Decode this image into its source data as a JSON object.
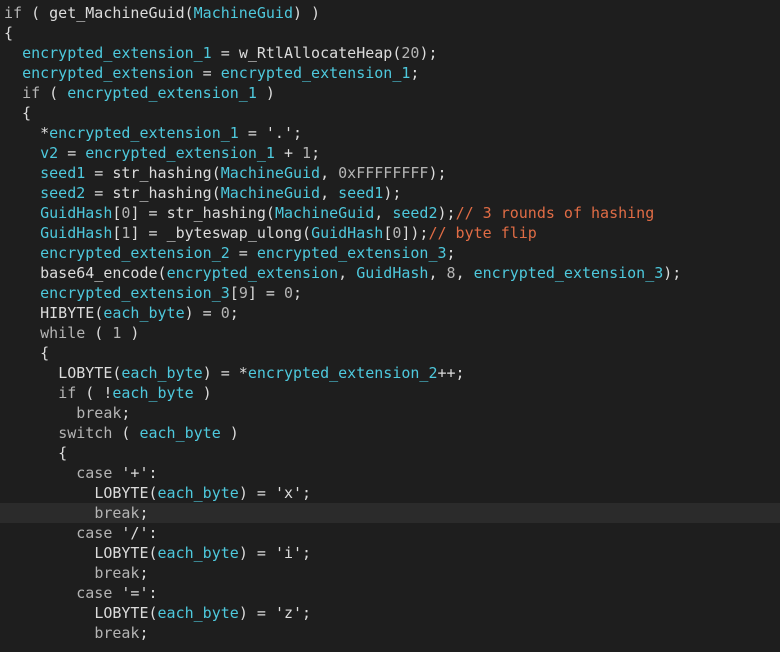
{
  "editor": {
    "current_line_index": 25,
    "colors": {
      "background": "#1e1e1e",
      "current_line": "#2b2b2b",
      "plain": "#dcdcdc",
      "keyword": "#b4b4b4",
      "variable": "#4ec9dd",
      "comment": "#e06c45",
      "number": "#b5b5b5"
    },
    "lines": [
      [
        [
          "k",
          "if"
        ],
        [
          "p",
          " ( "
        ],
        [
          "f",
          "get_MachineGuid"
        ],
        [
          "p",
          "("
        ],
        [
          "v",
          "MachineGuid"
        ],
        [
          "p",
          ") )"
        ]
      ],
      [
        [
          "p",
          "{"
        ]
      ],
      [
        [
          "p",
          "  "
        ],
        [
          "v",
          "encrypted_extension_1"
        ],
        [
          "p",
          " = "
        ],
        [
          "f",
          "w_RtlAllocateHeap"
        ],
        [
          "p",
          "("
        ],
        [
          "n",
          "20"
        ],
        [
          "p",
          ");"
        ]
      ],
      [
        [
          "p",
          "  "
        ],
        [
          "v",
          "encrypted_extension"
        ],
        [
          "p",
          " = "
        ],
        [
          "v",
          "encrypted_extension_1"
        ],
        [
          "p",
          ";"
        ]
      ],
      [
        [
          "p",
          "  "
        ],
        [
          "k",
          "if"
        ],
        [
          "p",
          " ( "
        ],
        [
          "v",
          "encrypted_extension_1"
        ],
        [
          "p",
          " )"
        ]
      ],
      [
        [
          "p",
          "  {"
        ]
      ],
      [
        [
          "p",
          "    *"
        ],
        [
          "v",
          "encrypted_extension_1"
        ],
        [
          "p",
          " = "
        ],
        [
          "s",
          "'.'"
        ],
        [
          "p",
          ";"
        ]
      ],
      [
        [
          "p",
          "    "
        ],
        [
          "v",
          "v2"
        ],
        [
          "p",
          " = "
        ],
        [
          "v",
          "encrypted_extension_1"
        ],
        [
          "p",
          " + "
        ],
        [
          "n",
          "1"
        ],
        [
          "p",
          ";"
        ]
      ],
      [
        [
          "p",
          "    "
        ],
        [
          "v",
          "seed1"
        ],
        [
          "p",
          " = "
        ],
        [
          "f",
          "str_hashing"
        ],
        [
          "p",
          "("
        ],
        [
          "v",
          "MachineGuid"
        ],
        [
          "p",
          ", "
        ],
        [
          "n",
          "0xFFFFFFFF"
        ],
        [
          "p",
          ");"
        ]
      ],
      [
        [
          "p",
          "    "
        ],
        [
          "v",
          "seed2"
        ],
        [
          "p",
          " = "
        ],
        [
          "f",
          "str_hashing"
        ],
        [
          "p",
          "("
        ],
        [
          "v",
          "MachineGuid"
        ],
        [
          "p",
          ", "
        ],
        [
          "v",
          "seed1"
        ],
        [
          "p",
          ");"
        ]
      ],
      [
        [
          "p",
          "    "
        ],
        [
          "v",
          "GuidHash"
        ],
        [
          "p",
          "["
        ],
        [
          "n",
          "0"
        ],
        [
          "p",
          "] = "
        ],
        [
          "f",
          "str_hashing"
        ],
        [
          "p",
          "("
        ],
        [
          "v",
          "MachineGuid"
        ],
        [
          "p",
          ", "
        ],
        [
          "v",
          "seed2"
        ],
        [
          "p",
          ");"
        ],
        [
          "c",
          "// 3 rounds of hashing"
        ]
      ],
      [
        [
          "p",
          "    "
        ],
        [
          "v",
          "GuidHash"
        ],
        [
          "p",
          "["
        ],
        [
          "n",
          "1"
        ],
        [
          "p",
          "] = "
        ],
        [
          "f",
          "_byteswap_ulong"
        ],
        [
          "p",
          "("
        ],
        [
          "v",
          "GuidHash"
        ],
        [
          "p",
          "["
        ],
        [
          "n",
          "0"
        ],
        [
          "p",
          "]);"
        ],
        [
          "c",
          "// byte flip"
        ]
      ],
      [
        [
          "p",
          "    "
        ],
        [
          "v",
          "encrypted_extension_2"
        ],
        [
          "p",
          " = "
        ],
        [
          "v",
          "encrypted_extension_3"
        ],
        [
          "p",
          ";"
        ]
      ],
      [
        [
          "p",
          "    "
        ],
        [
          "f",
          "base64_encode"
        ],
        [
          "p",
          "("
        ],
        [
          "v",
          "encrypted_extension"
        ],
        [
          "p",
          ", "
        ],
        [
          "v",
          "GuidHash"
        ],
        [
          "p",
          ", "
        ],
        [
          "n",
          "8"
        ],
        [
          "p",
          ", "
        ],
        [
          "v",
          "encrypted_extension_3"
        ],
        [
          "p",
          ");"
        ]
      ],
      [
        [
          "p",
          "    "
        ],
        [
          "v",
          "encrypted_extension_3"
        ],
        [
          "p",
          "["
        ],
        [
          "n",
          "9"
        ],
        [
          "p",
          "] = "
        ],
        [
          "n",
          "0"
        ],
        [
          "p",
          ";"
        ]
      ],
      [
        [
          "p",
          "    "
        ],
        [
          "m",
          "HIBYTE"
        ],
        [
          "p",
          "("
        ],
        [
          "v",
          "each_byte"
        ],
        [
          "p",
          ") = "
        ],
        [
          "n",
          "0"
        ],
        [
          "p",
          ";"
        ]
      ],
      [
        [
          "p",
          "    "
        ],
        [
          "k",
          "while"
        ],
        [
          "p",
          " ( "
        ],
        [
          "n",
          "1"
        ],
        [
          "p",
          " )"
        ]
      ],
      [
        [
          "p",
          "    {"
        ]
      ],
      [
        [
          "p",
          "      "
        ],
        [
          "m",
          "LOBYTE"
        ],
        [
          "p",
          "("
        ],
        [
          "v",
          "each_byte"
        ],
        [
          "p",
          ") = *"
        ],
        [
          "v",
          "encrypted_extension_2"
        ],
        [
          "p",
          "++;"
        ]
      ],
      [
        [
          "p",
          "      "
        ],
        [
          "k",
          "if"
        ],
        [
          "p",
          " ( !"
        ],
        [
          "v",
          "each_byte"
        ],
        [
          "p",
          " )"
        ]
      ],
      [
        [
          "p",
          "        "
        ],
        [
          "k",
          "break"
        ],
        [
          "p",
          ";"
        ]
      ],
      [
        [
          "p",
          "      "
        ],
        [
          "k",
          "switch"
        ],
        [
          "p",
          " ( "
        ],
        [
          "v",
          "each_byte"
        ],
        [
          "p",
          " )"
        ]
      ],
      [
        [
          "p",
          "      {"
        ]
      ],
      [
        [
          "p",
          "        "
        ],
        [
          "k",
          "case"
        ],
        [
          "p",
          " "
        ],
        [
          "s",
          "'+'"
        ],
        [
          "p",
          ":"
        ]
      ],
      [
        [
          "p",
          "          "
        ],
        [
          "m",
          "LOBYTE"
        ],
        [
          "p",
          "("
        ],
        [
          "v",
          "each_byte"
        ],
        [
          "p",
          ") = "
        ],
        [
          "s",
          "'x'"
        ],
        [
          "p",
          ";"
        ]
      ],
      [
        [
          "p",
          "          "
        ],
        [
          "k",
          "break"
        ],
        [
          "p",
          ";"
        ]
      ],
      [
        [
          "p",
          "        "
        ],
        [
          "k",
          "case"
        ],
        [
          "p",
          " "
        ],
        [
          "s",
          "'/'"
        ],
        [
          "p",
          ":"
        ]
      ],
      [
        [
          "p",
          "          "
        ],
        [
          "m",
          "LOBYTE"
        ],
        [
          "p",
          "("
        ],
        [
          "v",
          "each_byte"
        ],
        [
          "p",
          ") = "
        ],
        [
          "s",
          "'i'"
        ],
        [
          "p",
          ";"
        ]
      ],
      [
        [
          "p",
          "          "
        ],
        [
          "k",
          "break"
        ],
        [
          "p",
          ";"
        ]
      ],
      [
        [
          "p",
          "        "
        ],
        [
          "k",
          "case"
        ],
        [
          "p",
          " "
        ],
        [
          "s",
          "'='"
        ],
        [
          "p",
          ":"
        ]
      ],
      [
        [
          "p",
          "          "
        ],
        [
          "m",
          "LOBYTE"
        ],
        [
          "p",
          "("
        ],
        [
          "v",
          "each_byte"
        ],
        [
          "p",
          ") = "
        ],
        [
          "s",
          "'z'"
        ],
        [
          "p",
          ";"
        ]
      ],
      [
        [
          "p",
          "          "
        ],
        [
          "k",
          "break"
        ],
        [
          "p",
          ";"
        ]
      ]
    ]
  }
}
